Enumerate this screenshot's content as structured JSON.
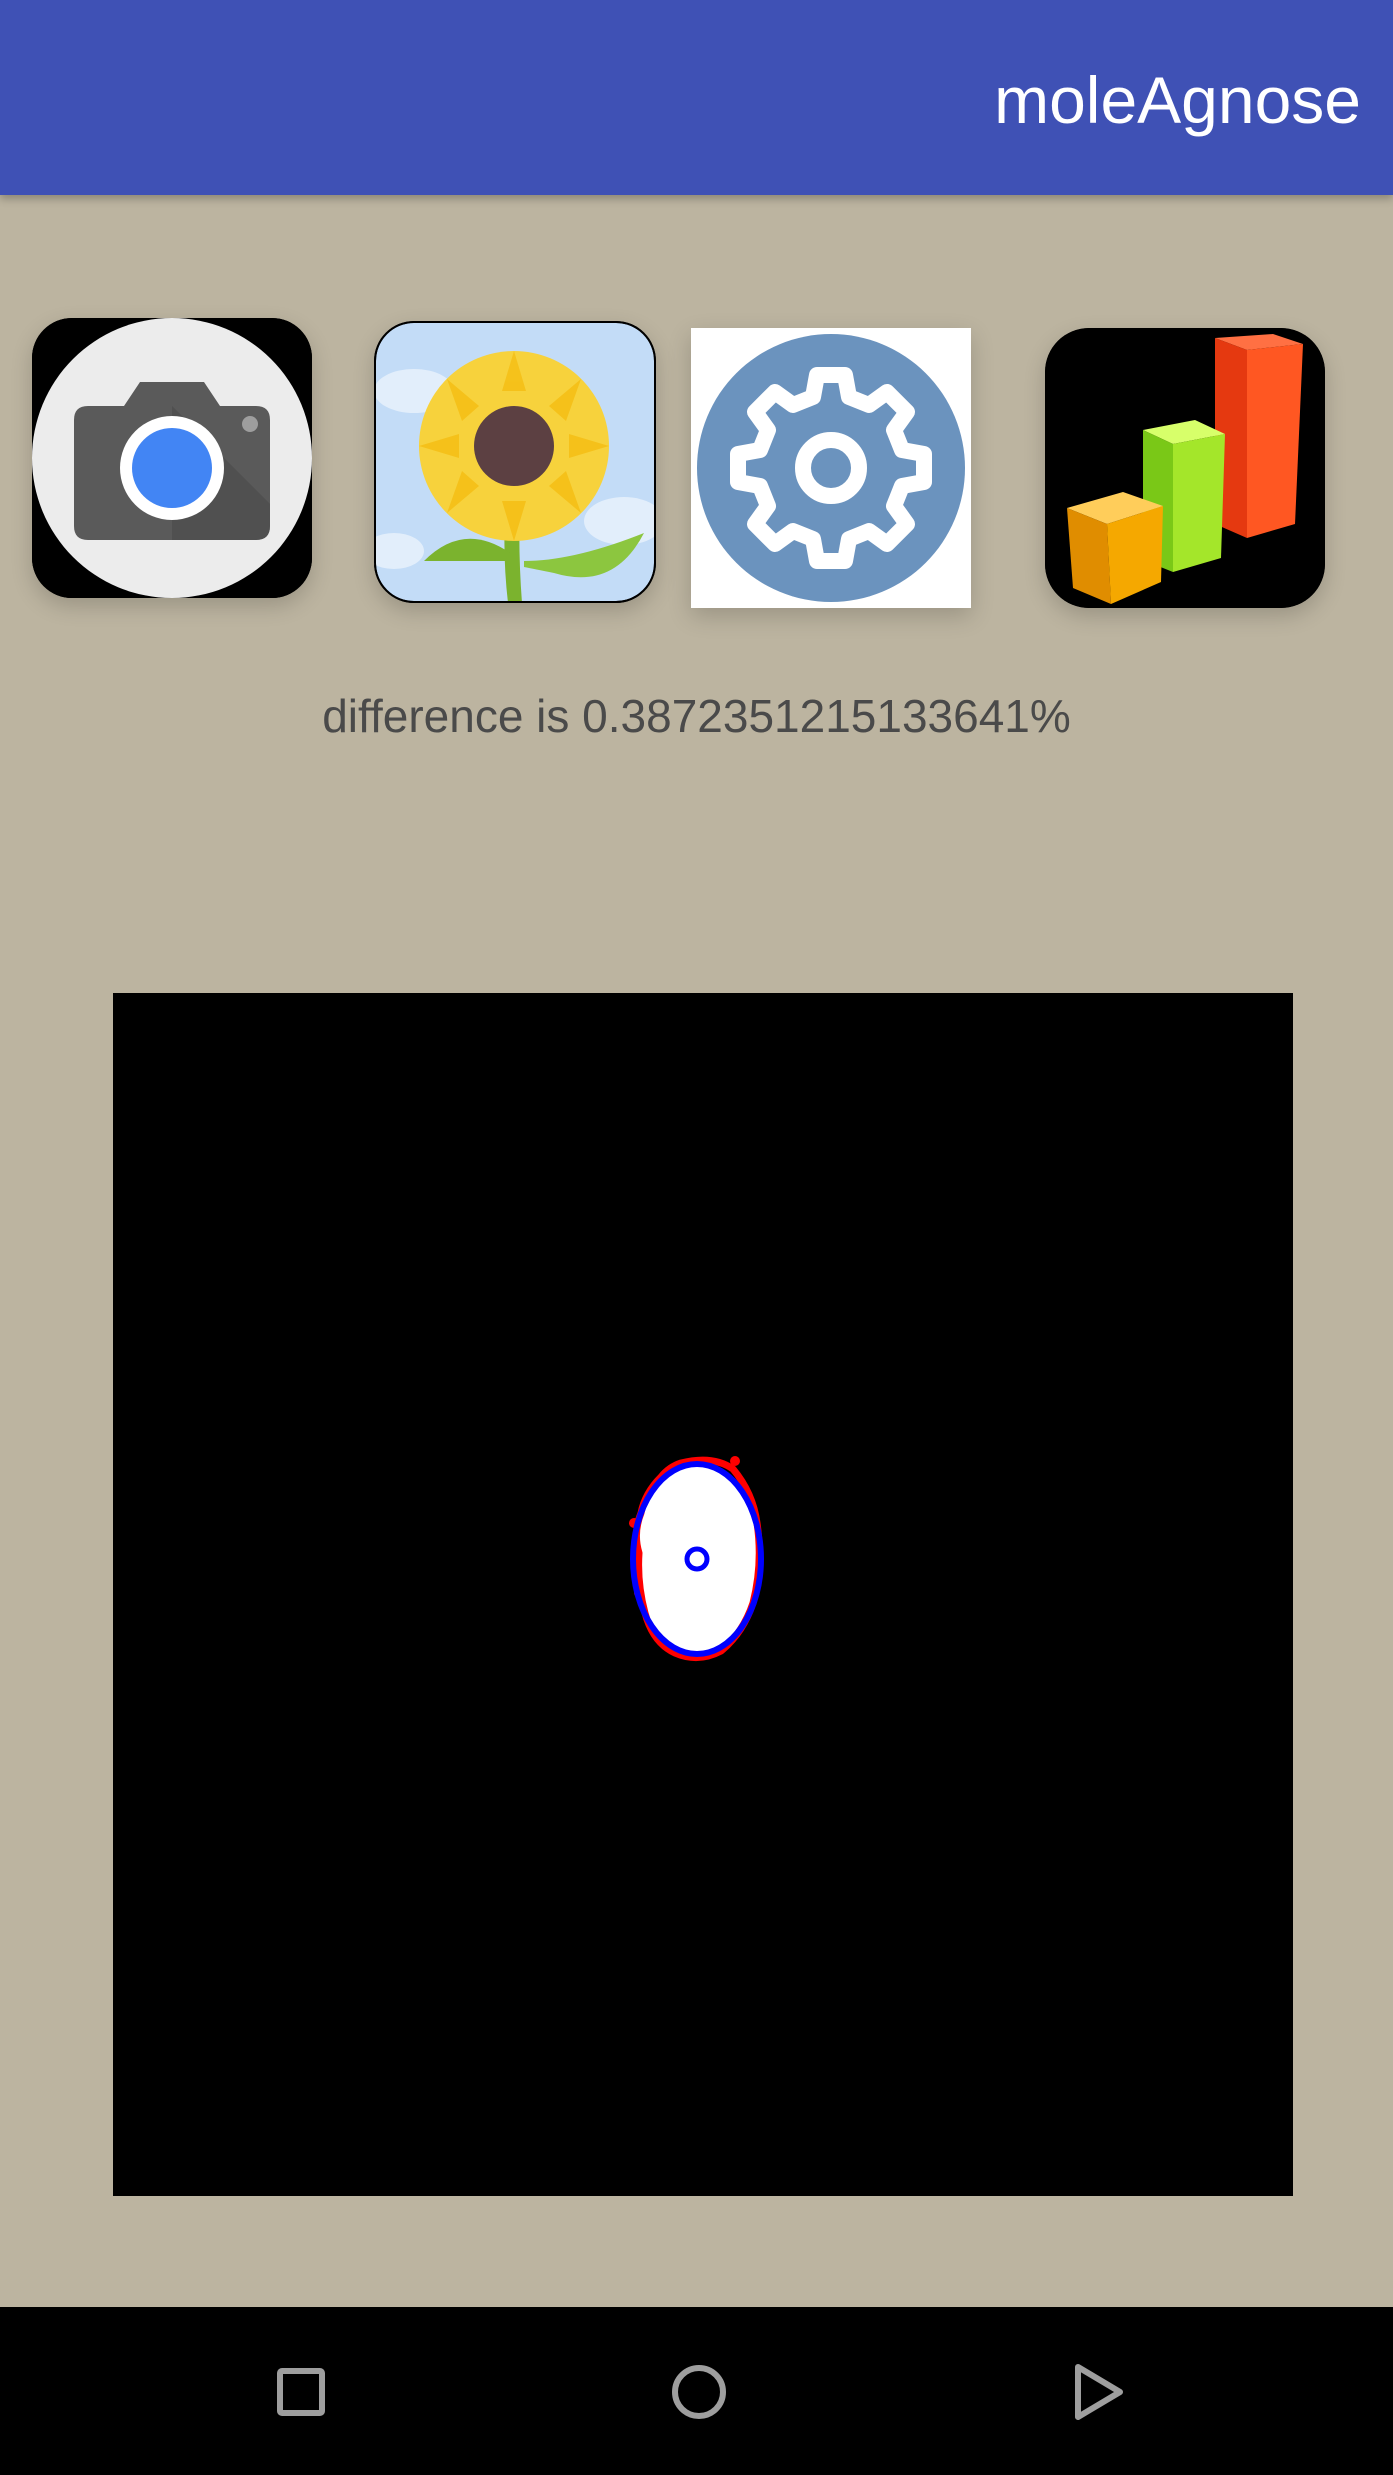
{
  "app_bar": {
    "title": "moleAgnose",
    "color": "#3f51b5"
  },
  "toolbar": {
    "buttons": [
      {
        "id": "camera",
        "icon": "camera-icon"
      },
      {
        "id": "gallery",
        "icon": "sunflower-gallery-icon"
      },
      {
        "id": "settings",
        "icon": "gear-icon"
      },
      {
        "id": "statistics",
        "icon": "bar-chart-icon"
      }
    ]
  },
  "result": {
    "difference_text": "difference is 0.3872351215133641%"
  },
  "analysis_image": {
    "description_colors": {
      "background": "#000000",
      "lesion_fill": "#ffffff",
      "contour": "#ff0000",
      "fitted_ellipse": "#0000ff"
    }
  },
  "nav_bar": {
    "buttons": [
      "recents-icon",
      "home-icon",
      "back-icon"
    ]
  },
  "colors": {
    "background": "#bcb4a0",
    "text": "#4a4a4a"
  }
}
